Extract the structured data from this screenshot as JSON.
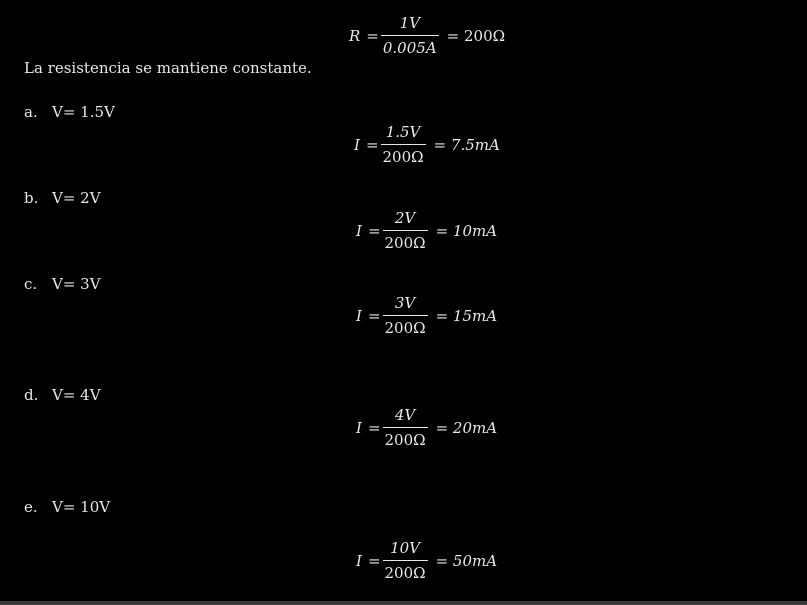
{
  "resistance_eq": {
    "lhs": "R",
    "eq_sign": "=",
    "numerator": "1V",
    "denominator": "0.005A",
    "result": "= 200Ω"
  },
  "statement": "La resistencia se mantiene constante.",
  "items": [
    {
      "marker": "a.",
      "label": "V= 1.5V",
      "eq": {
        "lhs": "I",
        "eq_sign": "=",
        "numerator": "1.5V",
        "denominator": "200Ω",
        "result": "= 7.5mA"
      }
    },
    {
      "marker": "b.",
      "label": "V= 2V",
      "eq": {
        "lhs": "I",
        "eq_sign": "=",
        "numerator": "2V",
        "denominator": "200Ω",
        "result": "= 10mA"
      }
    },
    {
      "marker": "c.",
      "label": "V= 3V",
      "eq": {
        "lhs": "I",
        "eq_sign": "=",
        "numerator": "3V",
        "denominator": "200Ω",
        "result": "= 15mA"
      }
    },
    {
      "marker": "d.",
      "label": "V= 4V",
      "eq": {
        "lhs": "I",
        "eq_sign": "=",
        "numerator": "4V",
        "denominator": "200Ω",
        "result": "= 20mA"
      }
    },
    {
      "marker": "e.",
      "label": "V= 10V",
      "eq": {
        "lhs": "I",
        "eq_sign": "=",
        "numerator": "10V",
        "denominator": "200Ω",
        "result": "= 50mA"
      }
    }
  ]
}
